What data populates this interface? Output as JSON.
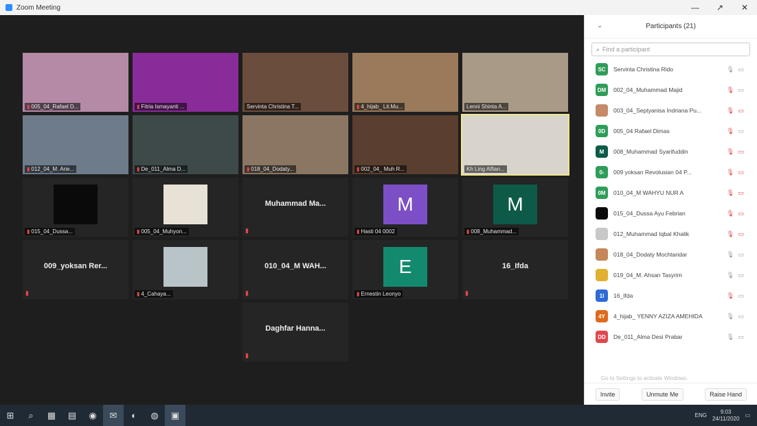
{
  "window": {
    "title": "Zoom Meeting"
  },
  "titlebar": {
    "minimize": "—",
    "maximize": "↗",
    "close": "✕"
  },
  "tiles": [
    {
      "label": "005_04_Rafael D...",
      "bg": "#b48aa6",
      "mic": true
    },
    {
      "label": "Fitria Ismayanti ...",
      "bg": "#8a2b9a",
      "mic": true
    },
    {
      "label": "Servinta Christina T...",
      "bg": "#6b4d3d",
      "mic": false
    },
    {
      "label": "4_hijab_ Lit.Mu...",
      "bg": "#9a7a5a",
      "mic": true
    },
    {
      "label": "Lenni Shinta A...",
      "bg": "#a89a86",
      "mic": false
    },
    {
      "label": "012_04_M. Arie...",
      "bg": "#6d7b8a",
      "mic": true
    },
    {
      "label": "De_011_Alma D...",
      "bg": "#3e4a4a",
      "mic": true
    },
    {
      "label": "018_04_Dodaty...",
      "bg": "#8a7663",
      "mic": true
    },
    {
      "label": "002_04_ Muh R...",
      "bg": "#5a3e30",
      "mic": true
    },
    {
      "label": "Kh Ling Alfian...",
      "bg": "#d8d4cc",
      "mic": false,
      "active": true
    },
    {
      "label": "015_04_Dussa...",
      "bg": "#252525",
      "mic": true,
      "box": "#0a0a0a"
    },
    {
      "label": "005_04_Muhyon...",
      "bg": "#252525",
      "mic": true,
      "box": "#e8e2d6"
    },
    {
      "label": "",
      "center": "Muhammad Ma...",
      "bg": "#252525",
      "mic": true
    },
    {
      "label": "Hasti 04 0002",
      "bg": "#252525",
      "mic": true,
      "letter": "M",
      "box": "#7d4fc6"
    },
    {
      "label": "008_Muhammad...",
      "bg": "#252525",
      "mic": true,
      "letter": "M",
      "box": "#0d5a48"
    },
    {
      "label": "",
      "center": "009_yoksan Rer...",
      "bg": "#252525",
      "mic": true
    },
    {
      "label": "4_Cahaya...",
      "bg": "#252525",
      "mic": true,
      "box": "#b8c4c8"
    },
    {
      "label": "",
      "center": "010_04_M WAH...",
      "bg": "#252525",
      "mic": true
    },
    {
      "label": "Ernestin Leonyo",
      "bg": "#252525",
      "mic": true,
      "letter": "E",
      "box": "#138a6e"
    },
    {
      "label": "",
      "center": "16_Ifda",
      "bg": "#252525",
      "mic": true
    },
    {
      "label": "",
      "center": "Daghfar Hanna...",
      "bg": "#252525",
      "mic": true
    }
  ],
  "panel": {
    "title": "Participants (21)",
    "collapse": "⌄",
    "search_placeholder": "Find a participant",
    "participants": [
      {
        "initials": "SC",
        "color": "#2e9d58",
        "name": "Servinta Christina Rido",
        "mic": "#999",
        "cam": "#999"
      },
      {
        "initials": "DM",
        "color": "#2e9d58",
        "name": "002_04_Muhammad Majid",
        "mic": "#e0474c",
        "cam": "#999"
      },
      {
        "initials": "",
        "color": "#c68a6a",
        "name": "003_04_Septyanisa Indriana Pu...",
        "mic": "#e0474c",
        "cam": "#e0474c"
      },
      {
        "initials": "0D",
        "color": "#2e9d58",
        "name": "005_04 Rafael Dimas",
        "mic": "#e0474c",
        "cam": "#999"
      },
      {
        "initials": "M",
        "color": "#0d5a48",
        "name": "008_Muhammad Syarifuddin",
        "mic": "#e0474c",
        "cam": "#e0474c"
      },
      {
        "initials": "0-",
        "color": "#2e9d58",
        "name": "009 yoksan Revolusian 04 P...",
        "mic": "#e0474c",
        "cam": "#e0474c"
      },
      {
        "initials": "0M",
        "color": "#2e9d58",
        "name": "010_04_M WAHYU NUR A",
        "mic": "#e0474c",
        "cam": "#e0474c"
      },
      {
        "initials": "",
        "color": "#0a0a0a",
        "name": "015_04_Dussa Ayu Febrian",
        "mic": "#e0474c",
        "cam": "#e0474c"
      },
      {
        "initials": "",
        "color": "#c8c8c8",
        "name": "012_Muhammad Iqbal Khalik",
        "mic": "#e0474c",
        "cam": "#e0474c"
      },
      {
        "initials": "",
        "color": "#c6875a",
        "name": "018_04_Dodaty Mochtaridar",
        "mic": "#999",
        "cam": "#999"
      },
      {
        "initials": "",
        "color": "#e0b030",
        "name": "019_04_M. Ahsan Tasyrim",
        "mic": "#999",
        "cam": "#999"
      },
      {
        "initials": "1I",
        "color": "#2d6cd6",
        "name": "16_Ifda",
        "mic": "#e0474c",
        "cam": "#999"
      },
      {
        "initials": "4Y",
        "color": "#e06a1c",
        "name": "4_hijab_ YENNY AZIZA AMEHIDA",
        "mic": "#999",
        "cam": "#999"
      },
      {
        "initials": "DD",
        "color": "#e0474c",
        "name": "De_011_Alma Desi Prabar",
        "mic": "#999",
        "cam": "#999"
      }
    ],
    "watermark": "Go to Settings to activate Windows.",
    "invite": "Invite",
    "unmute_me": "Unmute Me",
    "raise_hand": "Raise Hand"
  },
  "taskbar": {
    "start": "⊞",
    "apps": [
      "⌕",
      "▦",
      "▤",
      "◉",
      "✉",
      "◐",
      "◍",
      "▣"
    ],
    "lang": "ENG",
    "time": "9:03",
    "date": "24/11/2020"
  }
}
